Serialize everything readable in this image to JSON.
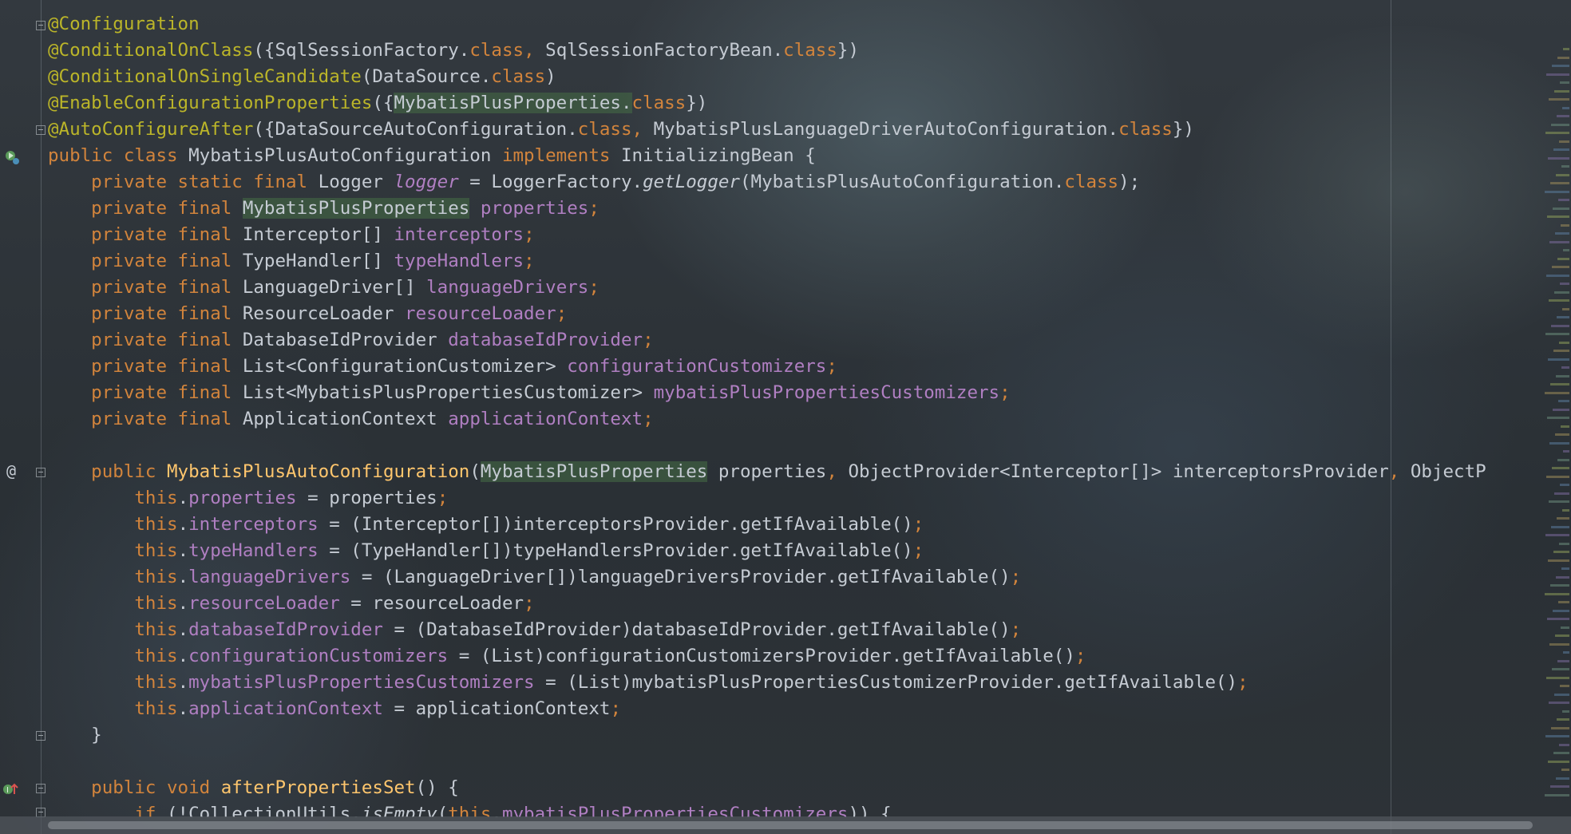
{
  "editor": {
    "lines": [
      [
        {
          "t": "@Configuration",
          "c": "tk-ann"
        }
      ],
      [
        {
          "t": "@ConditionalOnClass",
          "c": "tk-ann"
        },
        {
          "t": "({SqlSessionFactory.",
          "c": "tk-pun"
        },
        {
          "t": "class",
          "c": "tk-kw"
        },
        {
          "t": ", ",
          "c": "tk-kw"
        },
        {
          "t": "SqlSessionFactoryBean.",
          "c": "tk-pun"
        },
        {
          "t": "class",
          "c": "tk-kw"
        },
        {
          "t": "})",
          "c": "tk-pun"
        }
      ],
      [
        {
          "t": "@ConditionalOnSingleCandidate",
          "c": "tk-ann"
        },
        {
          "t": "(DataSource.",
          "c": "tk-pun"
        },
        {
          "t": "class",
          "c": "tk-kw"
        },
        {
          "t": ")",
          "c": "tk-pun"
        }
      ],
      [
        {
          "t": "@EnableConfigurationProperties",
          "c": "tk-ann"
        },
        {
          "t": "({",
          "c": "tk-pun"
        },
        {
          "t": "MybatisPlusProperties.",
          "c": "tk-pun tk-hl"
        },
        {
          "t": "class",
          "c": "tk-kw"
        },
        {
          "t": "})",
          "c": "tk-pun"
        }
      ],
      [
        {
          "t": "@AutoConfigureAfter",
          "c": "tk-ann"
        },
        {
          "t": "({DataSourceAutoConfiguration.",
          "c": "tk-pun"
        },
        {
          "t": "class",
          "c": "tk-kw"
        },
        {
          "t": ", ",
          "c": "tk-kw"
        },
        {
          "t": "MybatisPlusLanguageDriverAutoConfiguration.",
          "c": "tk-pun"
        },
        {
          "t": "class",
          "c": "tk-kw"
        },
        {
          "t": "})",
          "c": "tk-pun"
        }
      ],
      [
        {
          "t": "public class ",
          "c": "tk-kw"
        },
        {
          "t": "MybatisPlusAutoConfiguration ",
          "c": "tk-ty"
        },
        {
          "t": "implements ",
          "c": "tk-kw"
        },
        {
          "t": "InitializingBean {",
          "c": "tk-ty"
        }
      ],
      [
        {
          "t": "    private static final ",
          "c": "tk-kw"
        },
        {
          "t": "Logger ",
          "c": "tk-ty"
        },
        {
          "t": "logger",
          "c": "tk-sta"
        },
        {
          "t": " = LoggerFactory.",
          "c": "tk-pun"
        },
        {
          "t": "getLogger",
          "c": "tk-ita"
        },
        {
          "t": "(MybatisPlusAutoConfiguration.",
          "c": "tk-pun"
        },
        {
          "t": "class",
          "c": "tk-kw"
        },
        {
          "t": ");",
          "c": "tk-pun"
        }
      ],
      [
        {
          "t": "    private final ",
          "c": "tk-kw"
        },
        {
          "t": "MybatisPlusProperties",
          "c": "tk-ty tk-hl"
        },
        {
          "t": " ",
          "c": "tk-pun"
        },
        {
          "t": "properties",
          "c": "tk-fld"
        },
        {
          "t": ";",
          "c": "tk-semi"
        }
      ],
      [
        {
          "t": "    private final ",
          "c": "tk-kw"
        },
        {
          "t": "Interceptor[] ",
          "c": "tk-ty"
        },
        {
          "t": "interceptors",
          "c": "tk-fld"
        },
        {
          "t": ";",
          "c": "tk-semi"
        }
      ],
      [
        {
          "t": "    private final ",
          "c": "tk-kw"
        },
        {
          "t": "TypeHandler[] ",
          "c": "tk-ty"
        },
        {
          "t": "typeHandlers",
          "c": "tk-fld"
        },
        {
          "t": ";",
          "c": "tk-semi"
        }
      ],
      [
        {
          "t": "    private final ",
          "c": "tk-kw"
        },
        {
          "t": "LanguageDriver[] ",
          "c": "tk-ty"
        },
        {
          "t": "languageDrivers",
          "c": "tk-fld"
        },
        {
          "t": ";",
          "c": "tk-semi"
        }
      ],
      [
        {
          "t": "    private final ",
          "c": "tk-kw"
        },
        {
          "t": "ResourceLoader ",
          "c": "tk-ty"
        },
        {
          "t": "resourceLoader",
          "c": "tk-fld"
        },
        {
          "t": ";",
          "c": "tk-semi"
        }
      ],
      [
        {
          "t": "    private final ",
          "c": "tk-kw"
        },
        {
          "t": "DatabaseIdProvider ",
          "c": "tk-ty"
        },
        {
          "t": "databaseIdProvider",
          "c": "tk-fld"
        },
        {
          "t": ";",
          "c": "tk-semi"
        }
      ],
      [
        {
          "t": "    private final ",
          "c": "tk-kw"
        },
        {
          "t": "List<ConfigurationCustomizer> ",
          "c": "tk-ty"
        },
        {
          "t": "configurationCustomizers",
          "c": "tk-fld"
        },
        {
          "t": ";",
          "c": "tk-semi"
        }
      ],
      [
        {
          "t": "    private final ",
          "c": "tk-kw"
        },
        {
          "t": "List<MybatisPlusPropertiesCustomizer> ",
          "c": "tk-ty"
        },
        {
          "t": "mybatisPlusPropertiesCustomizers",
          "c": "tk-fld"
        },
        {
          "t": ";",
          "c": "tk-semi"
        }
      ],
      [
        {
          "t": "    private final ",
          "c": "tk-kw"
        },
        {
          "t": "ApplicationContext ",
          "c": "tk-ty"
        },
        {
          "t": "applicationContext",
          "c": "tk-fld"
        },
        {
          "t": ";",
          "c": "tk-semi"
        }
      ],
      [
        {
          "t": "",
          "c": "tk-pun"
        }
      ],
      [
        {
          "t": "    public ",
          "c": "tk-kw"
        },
        {
          "t": "MybatisPlusAutoConfiguration",
          "c": "tk-mth"
        },
        {
          "t": "(",
          "c": "tk-pun"
        },
        {
          "t": "MybatisPlusProperties",
          "c": "tk-ty tk-hl"
        },
        {
          "t": " properties",
          "c": "tk-pun"
        },
        {
          "t": ", ",
          "c": "tk-kw"
        },
        {
          "t": "ObjectProvider<Interceptor[]> interceptorsProvider",
          "c": "tk-pun"
        },
        {
          "t": ", ",
          "c": "tk-kw"
        },
        {
          "t": "ObjectP",
          "c": "tk-pun"
        }
      ],
      [
        {
          "t": "        this",
          "c": "tk-kw"
        },
        {
          "t": ".",
          "c": "tk-pun"
        },
        {
          "t": "properties",
          "c": "tk-fld"
        },
        {
          "t": " = properties",
          "c": "tk-pun"
        },
        {
          "t": ";",
          "c": "tk-semi"
        }
      ],
      [
        {
          "t": "        this",
          "c": "tk-kw"
        },
        {
          "t": ".",
          "c": "tk-pun"
        },
        {
          "t": "interceptors",
          "c": "tk-fld"
        },
        {
          "t": " = (Interceptor[])interceptorsProvider.getIfAvailable()",
          "c": "tk-pun"
        },
        {
          "t": ";",
          "c": "tk-semi"
        }
      ],
      [
        {
          "t": "        this",
          "c": "tk-kw"
        },
        {
          "t": ".",
          "c": "tk-pun"
        },
        {
          "t": "typeHandlers",
          "c": "tk-fld"
        },
        {
          "t": " = (TypeHandler[])typeHandlersProvider.getIfAvailable()",
          "c": "tk-pun"
        },
        {
          "t": ";",
          "c": "tk-semi"
        }
      ],
      [
        {
          "t": "        this",
          "c": "tk-kw"
        },
        {
          "t": ".",
          "c": "tk-pun"
        },
        {
          "t": "languageDrivers",
          "c": "tk-fld"
        },
        {
          "t": " = (LanguageDriver[])languageDriversProvider.getIfAvailable()",
          "c": "tk-pun"
        },
        {
          "t": ";",
          "c": "tk-semi"
        }
      ],
      [
        {
          "t": "        this",
          "c": "tk-kw"
        },
        {
          "t": ".",
          "c": "tk-pun"
        },
        {
          "t": "resourceLoader",
          "c": "tk-fld"
        },
        {
          "t": " = resourceLoader",
          "c": "tk-pun"
        },
        {
          "t": ";",
          "c": "tk-semi"
        }
      ],
      [
        {
          "t": "        this",
          "c": "tk-kw"
        },
        {
          "t": ".",
          "c": "tk-pun"
        },
        {
          "t": "databaseIdProvider",
          "c": "tk-fld"
        },
        {
          "t": " = (DatabaseIdProvider)databaseIdProvider.getIfAvailable()",
          "c": "tk-pun"
        },
        {
          "t": ";",
          "c": "tk-semi"
        }
      ],
      [
        {
          "t": "        this",
          "c": "tk-kw"
        },
        {
          "t": ".",
          "c": "tk-pun"
        },
        {
          "t": "configurationCustomizers",
          "c": "tk-fld"
        },
        {
          "t": " = (List)configurationCustomizersProvider.getIfAvailable()",
          "c": "tk-pun"
        },
        {
          "t": ";",
          "c": "tk-semi"
        }
      ],
      [
        {
          "t": "        this",
          "c": "tk-kw"
        },
        {
          "t": ".",
          "c": "tk-pun"
        },
        {
          "t": "mybatisPlusPropertiesCustomizers",
          "c": "tk-fld"
        },
        {
          "t": " = (List)mybatisPlusPropertiesCustomizerProvider.getIfAvailable()",
          "c": "tk-pun"
        },
        {
          "t": ";",
          "c": "tk-semi"
        }
      ],
      [
        {
          "t": "        this",
          "c": "tk-kw"
        },
        {
          "t": ".",
          "c": "tk-pun"
        },
        {
          "t": "applicationContext",
          "c": "tk-fld"
        },
        {
          "t": " = applicationContext",
          "c": "tk-pun"
        },
        {
          "t": ";",
          "c": "tk-semi"
        }
      ],
      [
        {
          "t": "    }",
          "c": "tk-pun"
        }
      ],
      [
        {
          "t": "",
          "c": "tk-pun"
        }
      ],
      [
        {
          "t": "    public void ",
          "c": "tk-kw"
        },
        {
          "t": "afterPropertiesSet",
          "c": "tk-mth"
        },
        {
          "t": "() {",
          "c": "tk-pun"
        }
      ],
      [
        {
          "t": "        if ",
          "c": "tk-kw"
        },
        {
          "t": "(!CollectionUtils.",
          "c": "tk-pun"
        },
        {
          "t": "isEmpty",
          "c": "tk-ita"
        },
        {
          "t": "(",
          "c": "tk-pun"
        },
        {
          "t": "this",
          "c": "tk-kw"
        },
        {
          "t": ".",
          "c": "tk-pun"
        },
        {
          "t": "mybatisPlusPropertiesCustomizers",
          "c": "tk-fld"
        },
        {
          "t": ")) {",
          "c": "tk-pun"
        }
      ]
    ]
  },
  "gutter": {
    "class_run_icon": "run-bean-icon",
    "constructor_marker": "@",
    "override_marker_icon": "implements-method-icon"
  },
  "colors": {
    "background": "#2b3036",
    "annotation": "#bbb529",
    "keyword": "#d2843c",
    "field": "#b07fc2",
    "method_decl": "#ffc66d",
    "text": "#c5cbd3"
  }
}
